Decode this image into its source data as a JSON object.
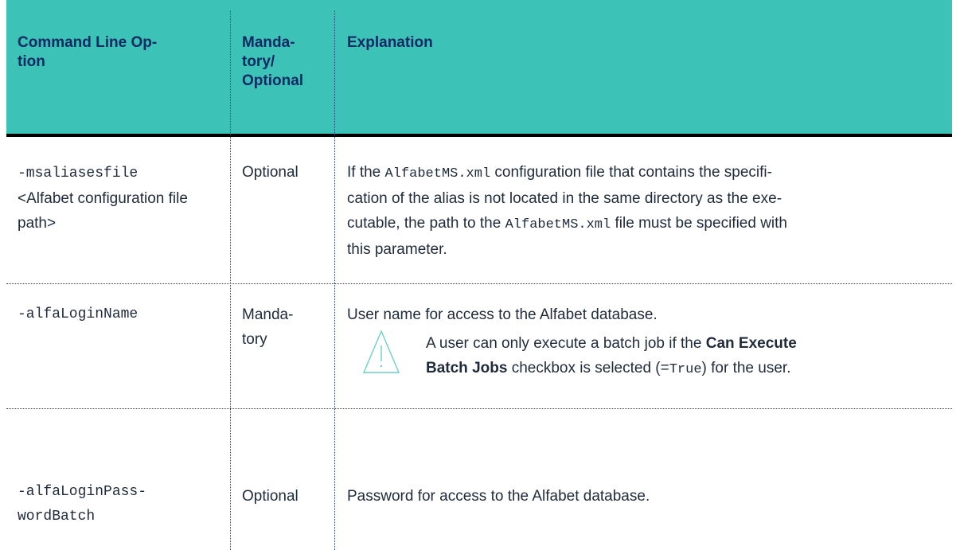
{
  "header": {
    "col1": "Command Line Op-\ntion",
    "col2": "Manda-\ntory/\nOptional",
    "col3": "Explanation"
  },
  "rows": [
    {
      "option_line1": "-msaliasesfile",
      "option_rest": "<Alfabet configuration file path>",
      "mandatory": "Optional",
      "expl_parts": [
        "If the ",
        "AlfabetMS.xml",
        " configuration file that contains the specifi-\ncation of the alias is not located in the same directory as the exe-\ncutable, the path to the ",
        "AlfabetMS.xml",
        " file must be specified with\nthis parameter."
      ]
    },
    {
      "option": "-alfaLoginName",
      "mandatory": "Manda-\ntory",
      "explanation": "User name for access to the Alfabet database.",
      "warning": {
        "pre": "A user can only execute a batch job if the ",
        "bold": "Can Execute\nBatch Jobs",
        "mid": " checkbox is selected (=",
        "code": "True",
        "post": ") for the user."
      }
    },
    {
      "option": "-alfaLoginPass-\nwordBatch",
      "mandatory": "Optional",
      "explanation": "Password for access to the Alfabet database."
    }
  ],
  "colors": {
    "header_bg": "#3dc2b8",
    "header_text": "#0d2a63",
    "rule": "#000000",
    "warning_icon": "#6ccfc7"
  },
  "icons": {
    "warning": "warning-triangle-icon"
  }
}
